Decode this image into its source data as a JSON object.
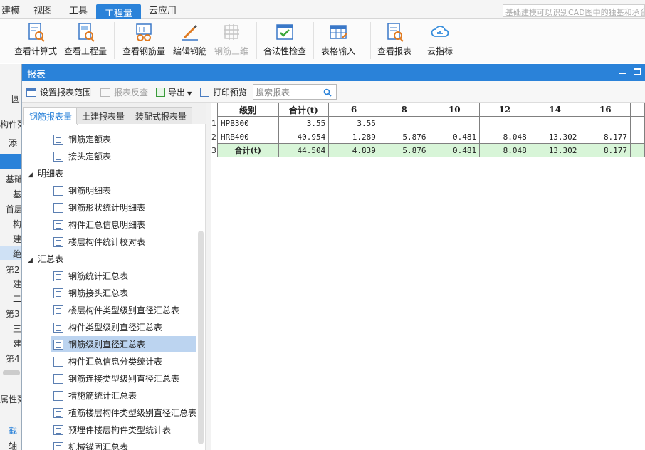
{
  "menubar": {
    "items": [
      "建模",
      "视图",
      "工具",
      "工程量",
      "云应用"
    ],
    "active_index": 3,
    "search_placeholder": "基础建模可以识别CAD图中的独基和承台"
  },
  "ribbon": {
    "buttons": [
      {
        "label": "查看计算式",
        "icon": "calc-view-icon"
      },
      {
        "label": "查看工程量",
        "icon": "quantity-view-icon"
      },
      {
        "label": "查看钢筋量",
        "icon": "rebar-view-icon"
      },
      {
        "label": "编辑钢筋",
        "icon": "rebar-edit-icon"
      },
      {
        "label": "钢筋三维",
        "icon": "rebar-3d-icon",
        "disabled": true
      },
      {
        "label": "合法性检查",
        "icon": "validity-check-icon"
      },
      {
        "label": "表格输入",
        "icon": "table-input-icon"
      },
      {
        "label": "查看报表",
        "icon": "report-view-icon"
      },
      {
        "label": "云指标",
        "icon": "cloud-index-icon"
      }
    ]
  },
  "leftpane": {
    "items": [
      "圆",
      "构件列",
      "添",
      "基础",
      "基",
      "首层",
      "构",
      "建",
      "绝",
      "第2",
      "建",
      "二",
      "第3",
      "三",
      "建",
      "第4",
      "属性列",
      "截",
      "轴"
    ]
  },
  "report_window": {
    "title": "报表",
    "toolbar": {
      "set_range": "设置报表范围",
      "reverse_check": "报表反查",
      "export": "导出",
      "print_preview": "打印预览",
      "search_placeholder": "搜索报表"
    },
    "tabs": [
      "钢筋报表量",
      "土建报表量",
      "装配式报表量"
    ],
    "active_tab": 0,
    "tree": [
      {
        "type": "leaf",
        "label": "钢筋定额表"
      },
      {
        "type": "leaf",
        "label": "接头定额表"
      },
      {
        "type": "group",
        "label": "明细表"
      },
      {
        "type": "leaf",
        "label": "钢筋明细表"
      },
      {
        "type": "leaf",
        "label": "钢筋形状统计明细表"
      },
      {
        "type": "leaf",
        "label": "构件汇总信息明细表"
      },
      {
        "type": "leaf",
        "label": "楼层构件统计校对表"
      },
      {
        "type": "group",
        "label": "汇总表"
      },
      {
        "type": "leaf",
        "label": "钢筋统计汇总表"
      },
      {
        "type": "leaf",
        "label": "钢筋接头汇总表"
      },
      {
        "type": "leaf",
        "label": "楼层构件类型级别直径汇总表"
      },
      {
        "type": "leaf",
        "label": "构件类型级别直径汇总表"
      },
      {
        "type": "leaf",
        "label": "钢筋级别直径汇总表",
        "selected": true
      },
      {
        "type": "leaf",
        "label": "构件汇总信息分类统计表"
      },
      {
        "type": "leaf",
        "label": "钢筋连接类型级别直径汇总表"
      },
      {
        "type": "leaf",
        "label": "措施筋统计汇总表"
      },
      {
        "type": "leaf",
        "label": "植筋楼层构件类型级别直径汇总表"
      },
      {
        "type": "leaf",
        "label": "预埋件楼层构件类型统计表"
      },
      {
        "type": "leaf",
        "label": "机械锚固汇总表"
      }
    ],
    "table": {
      "headers": [
        "级别",
        "合计(t)",
        "6",
        "8",
        "10",
        "12",
        "14",
        "16"
      ],
      "rows": [
        {
          "rn": "1",
          "cells": [
            "HPB300",
            "3.55",
            "3.55",
            "",
            "",
            "",
            "",
            ""
          ]
        },
        {
          "rn": "2",
          "cells": [
            "HRB400",
            "40.954",
            "1.289",
            "5.876",
            "0.481",
            "8.048",
            "13.302",
            "8.177"
          ]
        },
        {
          "rn": "3",
          "cells": [
            "合计(t)",
            "44.504",
            "4.839",
            "5.876",
            "0.481",
            "8.048",
            "13.302",
            "8.177"
          ],
          "total": true
        }
      ]
    }
  }
}
